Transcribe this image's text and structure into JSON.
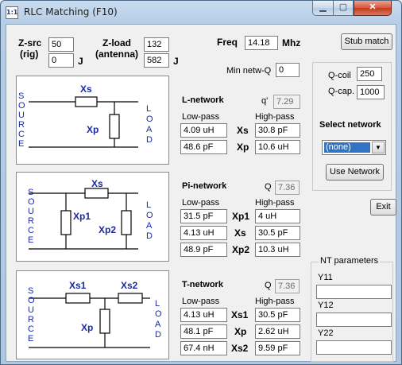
{
  "window": {
    "title": "RLC Matching (F10)",
    "icon_text": "1:1",
    "min_glyph": "▁",
    "max_glyph": "▢",
    "close_glyph": "✕"
  },
  "source": {
    "label_line1": "Z-src",
    "label_line2": "(rig)",
    "r": "50",
    "j": "0",
    "j_label": "J"
  },
  "load": {
    "label_line1": "Z-load",
    "label_line2": "(antenna)",
    "r": "132",
    "j": "582",
    "j_label": "J"
  },
  "freq": {
    "label": "Freq",
    "value": "14.18",
    "unit": "Mhz"
  },
  "min_q": {
    "label": "Min netw-Q",
    "value": "0"
  },
  "stub_match_label": "Stub match",
  "q_coil": {
    "label": "Q-coil",
    "value": "250"
  },
  "q_cap": {
    "label": "Q-cap.",
    "value": "1000"
  },
  "select_network": {
    "label": "Select network",
    "value": "(none)"
  },
  "use_network_label": "Use Network",
  "exit_label": "Exit",
  "nt_params": {
    "title": "NT parameters",
    "y11": "Y11",
    "y12": "Y12",
    "y22": "Y22",
    "y11_value": "",
    "y12_value": "",
    "y22_value": ""
  },
  "schematic": {
    "source_letters": [
      "S",
      "O",
      "U",
      "R",
      "C",
      "E"
    ],
    "load_letters": [
      "L",
      "O",
      "A",
      "D"
    ]
  },
  "l_network": {
    "title": "L-network",
    "q_label": "q'",
    "q_value": "7.29",
    "low_pass": "Low-pass",
    "high_pass": "High-pass",
    "rows": [
      {
        "name": "Xs",
        "low": "4.09 uH",
        "high": "30.8 pF"
      },
      {
        "name": "Xp",
        "low": "48.6 pF",
        "high": "10.6 uH"
      }
    ],
    "diagram": {
      "xs": "Xs",
      "xp": "Xp"
    }
  },
  "pi_network": {
    "title": "Pi-network",
    "q_label": "Q",
    "q_value": "7.36",
    "low_pass": "Low-pass",
    "high_pass": "High-pass",
    "rows": [
      {
        "name": "Xp1",
        "low": "31.5 pF",
        "high": "4 uH"
      },
      {
        "name": "Xs",
        "low": "4.13 uH",
        "high": "30.5 pF"
      },
      {
        "name": "Xp2",
        "low": "48.9 pF",
        "high": "10.3 uH"
      }
    ],
    "diagram": {
      "xs": "Xs",
      "xp1": "Xp1",
      "xp2": "Xp2"
    }
  },
  "t_network": {
    "title": "T-network",
    "q_label": "Q",
    "q_value": "7.36",
    "low_pass": "Low-pass",
    "high_pass": "High-pass",
    "rows": [
      {
        "name": "Xs1",
        "low": "4.13 uH",
        "high": "30.5 pF"
      },
      {
        "name": "Xp",
        "low": "48.1 pF",
        "high": "2.62 uH"
      },
      {
        "name": "Xs2",
        "low": "67.4 nH",
        "high": "9.59 pF"
      }
    ],
    "diagram": {
      "xs1": "Xs1",
      "xs2": "Xs2",
      "xp": "Xp"
    }
  }
}
